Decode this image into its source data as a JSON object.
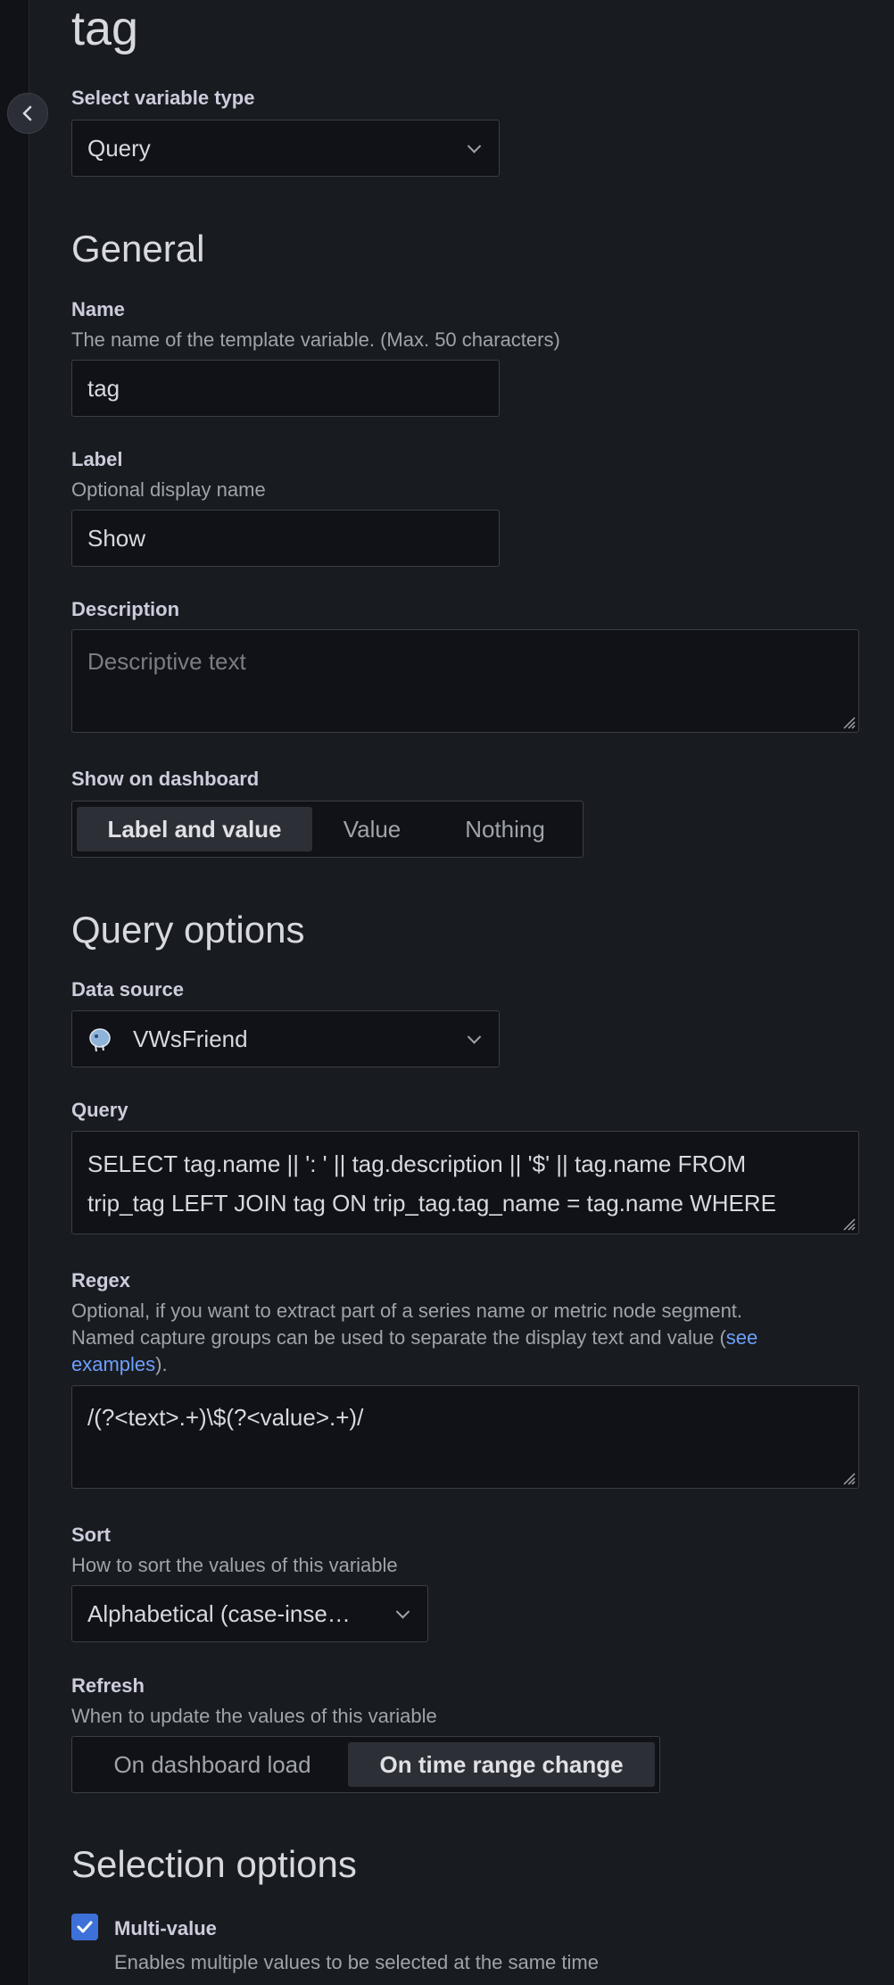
{
  "page": {
    "title": "tag"
  },
  "variable_type": {
    "label": "Select variable type",
    "value": "Query"
  },
  "general": {
    "title": "General",
    "name": {
      "label": "Name",
      "description": "The name of the template variable. (Max. 50 characters)",
      "value": "tag"
    },
    "label": {
      "label": "Label",
      "description": "Optional display name",
      "value": "Show"
    },
    "description": {
      "label": "Description",
      "placeholder": "Descriptive text",
      "value": ""
    },
    "show_on_dashboard": {
      "label": "Show on dashboard",
      "options": [
        "Label and value",
        "Value",
        "Nothing"
      ],
      "selected": "Label and value"
    }
  },
  "query_options": {
    "title": "Query options",
    "data_source": {
      "label": "Data source",
      "value": "VWsFriend",
      "icon": "postgresql-icon"
    },
    "query": {
      "label": "Query",
      "line1": "SELECT tag.name || ': ' || tag.description || '$' || tag.name FROM",
      "line2": "trip_tag LEFT JOIN tag ON trip_tag.tag_name = tag.name WHERE"
    },
    "regex": {
      "label": "Regex",
      "description_line1": "Optional, if you want to extract part of a series name or metric node segment.",
      "description_line2": "Named capture groups can be used to separate the display text and value (",
      "link_part1": "see",
      "link_part2": "examples",
      "description_end": ").",
      "value": "/(?<text>.+)\\$(?<value>.+)/"
    },
    "sort": {
      "label": "Sort",
      "description": "How to sort the values of this variable",
      "value": "Alphabetical (case-inse…"
    },
    "refresh": {
      "label": "Refresh",
      "description": "When to update the values of this variable",
      "options": [
        "On dashboard load",
        "On time range change"
      ],
      "selected": "On time range change"
    }
  },
  "selection_options": {
    "title": "Selection options",
    "multi_value": {
      "label": "Multi-value",
      "description": "Enables multiple values to be selected at the same time",
      "checked": true
    }
  },
  "colors": {
    "accent": "#3d71d9",
    "link": "#6e9fff",
    "background": "#181b1f",
    "input_bg": "#111217"
  }
}
